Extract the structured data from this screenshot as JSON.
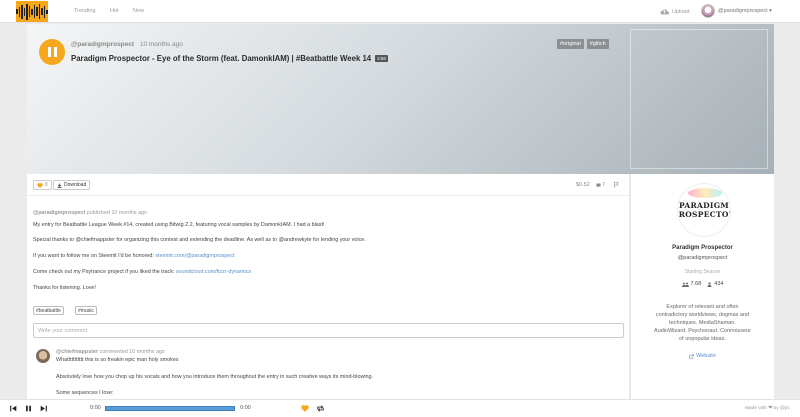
{
  "nav": {
    "links": [
      "Trending",
      "Hot",
      "New"
    ],
    "upload_label": "Upload",
    "user_label": "@paradigmprospect ▾"
  },
  "hero": {
    "artist": "@paradigmprospect",
    "ago": "10 months ago",
    "title": "Paradigm Prospector - Eye of the Storm (feat. DamonkIAM) | #Beatbattle Week 14",
    "duration": "3:58",
    "tags": [
      "#original",
      "#glitch"
    ]
  },
  "actions": {
    "like_count": "8",
    "download_label": "Download",
    "payout": "$0.52",
    "comment_count": "7"
  },
  "post": {
    "author": "@paradigmprospect",
    "published": "published 10 months ago",
    "line1": "My entry for Beatbattle League Week #14, created using Bitwig 2.2, featuring vocal samples by DamonkIAM. I had a blast!",
    "line2": "Special thanks to @chiefmappster for organizing this contest and extending the deadline. As well as to @andrewkyte for lending your voice.",
    "line3_prefix": "If you want to follow me on Steemit I'd be honored:",
    "line3_link": "steemit.com/@paradigmprospect",
    "line4_prefix": "Come check out my Psytrance project if you liked the track:",
    "line4_link": "soundcloud.com/fizzr-dynamics",
    "line5": "Thanks for listening. Love!",
    "tags": [
      "#beatbattle",
      "#music"
    ],
    "comment_placeholder": "Write your comment"
  },
  "comment": {
    "author": "@chiefmappster",
    "meta": "commented 10 months ago",
    "line1": "Whattttttttttt this is so freakin epic man holy smokes",
    "line2": "Absolutely love how you chop up his vocals and how you introduce them  throughout the entry in such creative ways its mind-blowing.",
    "line3": "Some sequences I love:"
  },
  "profile": {
    "avatar_line1": "PARADIGM",
    "avatar_line2": "PROSPECTOR",
    "name": "Paradigm Prospector",
    "handle": "@paradigmprospect",
    "season": "Starting Season",
    "followers": "7.68",
    "following": "434",
    "bio1": "Explorer of relevant and often",
    "bio2": "contradictory worldviews, dogmas and",
    "bio3": "techniques. MediaShaman.",
    "bio4": "AudioWizard. Psychonaut. Connoisseur",
    "bio5": "of unpopular ideas.",
    "website_label": "Website"
  },
  "player": {
    "time_start": "0:00",
    "time_end": "0:00",
    "progress": 1.0,
    "credit": "Made with ❤ by @jrc"
  },
  "colors": {
    "accent": "#f6a71b",
    "link": "#5b8fd0",
    "progress": "#5b9bd5"
  },
  "icons": [
    "play-pause-icon",
    "heart-icon",
    "download-icon",
    "comment-icon",
    "flag-icon",
    "users-icon",
    "globe-icon",
    "repeat-icon",
    "prev-icon",
    "next-icon"
  ]
}
